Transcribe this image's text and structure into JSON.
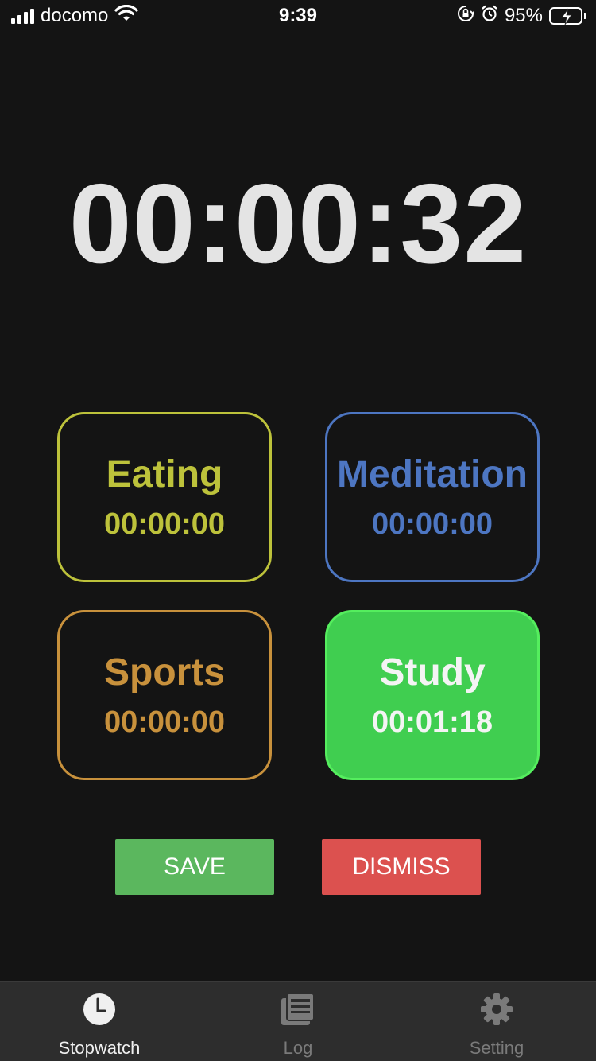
{
  "status_bar": {
    "carrier": "docomo",
    "time": "9:39",
    "battery_percent": "95%",
    "battery_level": 0.95,
    "icons": [
      "signal-icon",
      "wifi-icon",
      "orientation-lock-icon",
      "alarm-icon",
      "battery-icon"
    ]
  },
  "stopwatch": {
    "elapsed": "00:00:32"
  },
  "categories": [
    {
      "name": "Eating",
      "time": "00:00:00",
      "color": "#bdc23b",
      "active": false
    },
    {
      "name": "Meditation",
      "time": "00:00:00",
      "color": "#4d76c2",
      "active": false
    },
    {
      "name": "Sports",
      "time": "00:00:00",
      "color": "#c8913c",
      "active": false
    },
    {
      "name": "Study",
      "time": "00:01:18",
      "color": "#40ce50",
      "active": true
    }
  ],
  "actions": {
    "save_label": "SAVE",
    "save_color": "#5bb75e",
    "dismiss_label": "DISMISS",
    "dismiss_color": "#dc514f"
  },
  "tab_bar": {
    "tabs": [
      {
        "label": "Stopwatch",
        "icon": "clock-icon",
        "active": true
      },
      {
        "label": "Log",
        "icon": "log-icon",
        "active": false
      },
      {
        "label": "Setting",
        "icon": "gear-icon",
        "active": false
      }
    ]
  }
}
